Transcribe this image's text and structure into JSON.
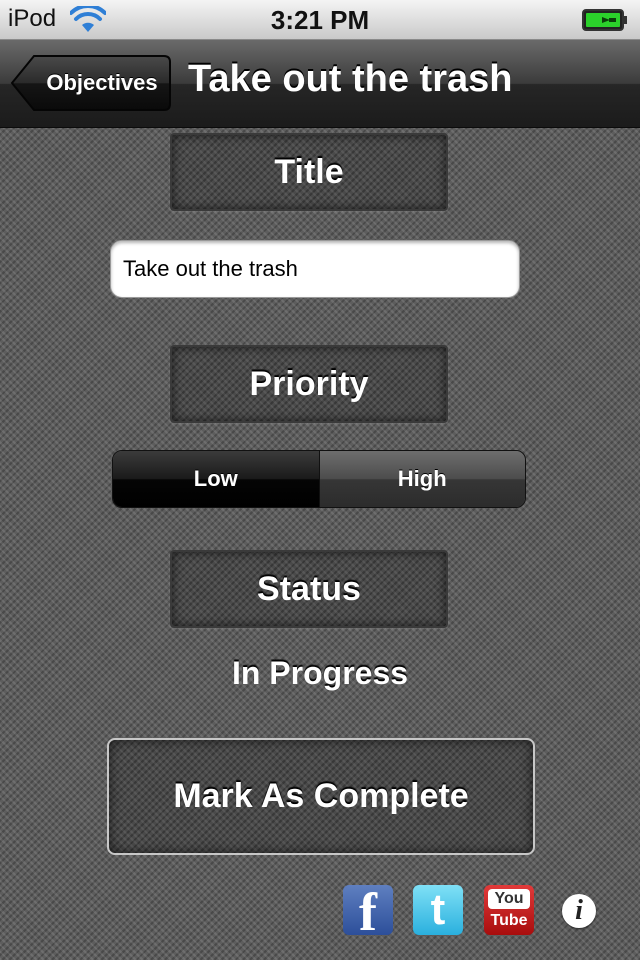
{
  "status_bar": {
    "carrier": "iPod",
    "time": "3:21 PM",
    "icons": [
      "wifi-icon",
      "battery-charging-icon"
    ]
  },
  "nav": {
    "back_label": "Objectives",
    "title": "Take out the trash"
  },
  "sections": {
    "title_label": "Title",
    "priority_label": "Priority",
    "status_label": "Status"
  },
  "title_field": {
    "value": "Take out the trash"
  },
  "priority": {
    "options": [
      "Low",
      "High"
    ],
    "selected": "Low"
  },
  "status": {
    "value": "In Progress"
  },
  "actions": {
    "complete_label": "Mark As Complete"
  },
  "social": {
    "facebook": "f",
    "twitter": "t",
    "youtube_top": "You",
    "youtube_bottom": "Tube",
    "info": "i",
    "icons": [
      "facebook-icon",
      "twitter-icon",
      "youtube-icon",
      "info-icon"
    ]
  },
  "colors": {
    "text": "#ffffff",
    "background": "#5d5d5d",
    "selected_segment": "#000000",
    "facebook": "#3b5998",
    "twitter": "#33ccff",
    "youtube": "#cc181e",
    "battery_charge": "#2bd12b"
  }
}
